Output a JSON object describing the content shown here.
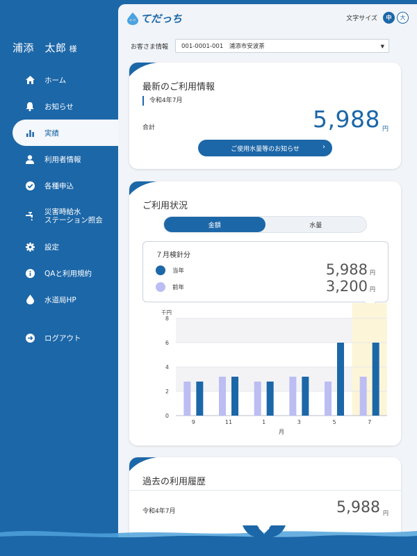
{
  "user": {
    "name": "浦添　太郎",
    "suffix": "様"
  },
  "nav": [
    {
      "label": "ホーム",
      "icon": "home-icon"
    },
    {
      "label": "お知らせ",
      "icon": "bell-icon"
    },
    {
      "label": "実績",
      "icon": "bar-chart-icon",
      "active": true
    },
    {
      "label": "利用者情報",
      "icon": "person-icon"
    },
    {
      "label": "各種申込",
      "icon": "check-circle-icon"
    },
    {
      "label": "災害時給水\nステーション照会",
      "icon": "faucet-icon"
    },
    {
      "label": "設定",
      "icon": "gear-icon"
    },
    {
      "label": "QAと利用規約",
      "icon": "info-icon"
    },
    {
      "label": "水道局HP",
      "icon": "water-drop-icon"
    },
    {
      "label": "ログアウト",
      "icon": "logout-icon"
    }
  ],
  "header": {
    "logo": "てだっち",
    "font_size_label": "文字サイズ",
    "font_size_medium": "中",
    "font_size_large": "大"
  },
  "customer": {
    "label": "お客さま情報",
    "selected": "001-0001-001　浦添市安波茶"
  },
  "latest": {
    "title": "最新のご利用情報",
    "period": "令和4年7月",
    "total_label": "合計",
    "total_value": "5,988",
    "unit": "円",
    "notice_button": "ご使用水量等のお知らせ"
  },
  "usage": {
    "title": "ご利用状況",
    "tab_amount": "金額",
    "tab_volume": "水量",
    "tooltip": {
      "title": "７月検針分",
      "current_label": "当年",
      "current_value": "5,988",
      "previous_label": "前年",
      "previous_value": "3,200",
      "unit": "円"
    }
  },
  "chart_data": {
    "type": "bar",
    "ylabel": "千円",
    "xlabel": "月",
    "ylim": [
      0,
      8
    ],
    "yticks": [
      0,
      2,
      4,
      6,
      8
    ],
    "categories": [
      "9",
      "11",
      "1",
      "3",
      "5",
      "7"
    ],
    "series": [
      {
        "name": "前年",
        "values": [
          2.8,
          3.2,
          2.8,
          3.2,
          2.8,
          3.2
        ],
        "color": "#bcbdf2"
      },
      {
        "name": "当年",
        "values": [
          2.8,
          3.2,
          2.8,
          3.2,
          6.0,
          6.0
        ],
        "color": "#1c67a8"
      }
    ],
    "highlight_category": "7",
    "grid": true
  },
  "history": {
    "title": "過去の利用履歴",
    "period": "令和4年7月",
    "value": "5,988",
    "unit": "円"
  },
  "colors": {
    "primary": "#1c67a8",
    "previous": "#bcbdf2",
    "highlight": "#fdf5d8",
    "background": "#f1f4f8"
  }
}
